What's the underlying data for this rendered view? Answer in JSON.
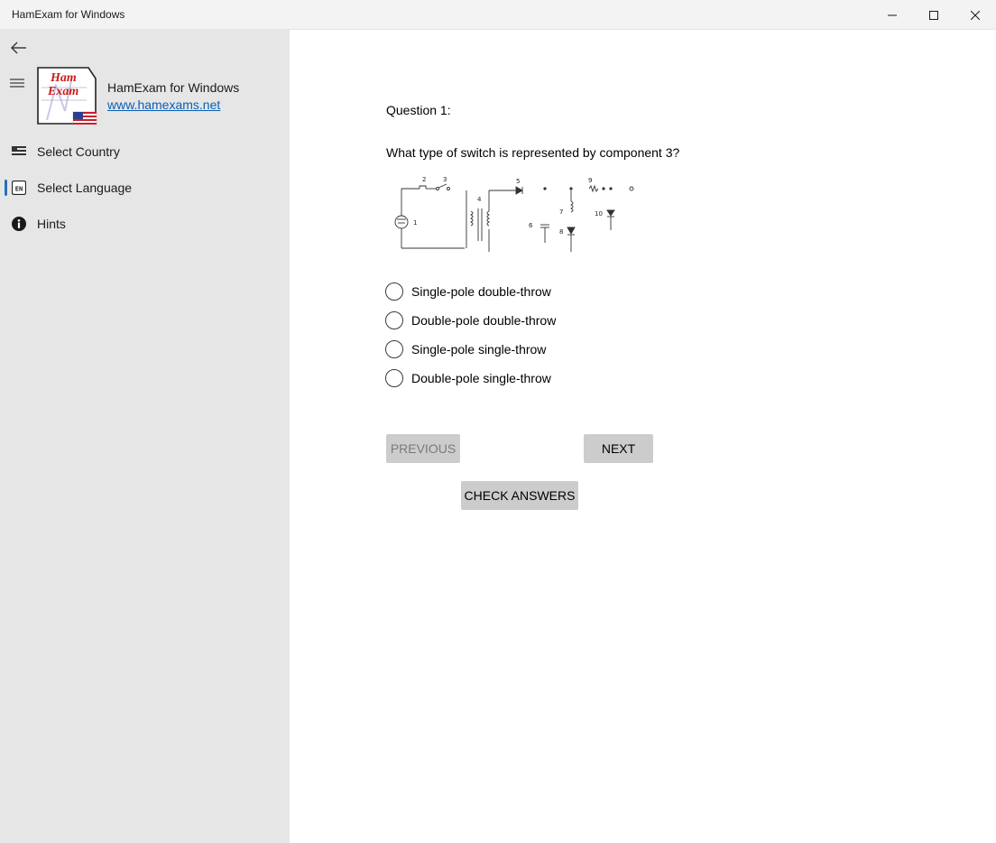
{
  "window": {
    "title": "HamExam for Windows"
  },
  "sidebar": {
    "app_name": "HamExam for Windows",
    "app_link": "www.hamexams.net",
    "logo_text": [
      "Ham",
      "Exam"
    ],
    "items": [
      {
        "label": "Select Country",
        "icon": "flag-icon"
      },
      {
        "label": "Select Language",
        "icon": "language-en-icon",
        "selected": true
      },
      {
        "label": "Hints",
        "icon": "info-icon"
      }
    ]
  },
  "question": {
    "number_label": "Question 1:",
    "text": "What type of switch is represented by component 3?",
    "diagram_labels": [
      "1",
      "2",
      "3",
      "4",
      "5",
      "6",
      "7",
      "8",
      "9",
      "10"
    ],
    "options": [
      "Single-pole double-throw",
      "Double-pole double-throw",
      "Single-pole single-throw",
      "Double-pole single-throw"
    ]
  },
  "buttons": {
    "previous": "PREVIOUS",
    "next": "NEXT",
    "check": "CHECK ANSWERS"
  },
  "colors": {
    "sidebar_bg": "#e6e6e6",
    "link": "#0a5fb4",
    "selected_indicator": "#2a6fb8",
    "button_bg": "#cccccc"
  }
}
